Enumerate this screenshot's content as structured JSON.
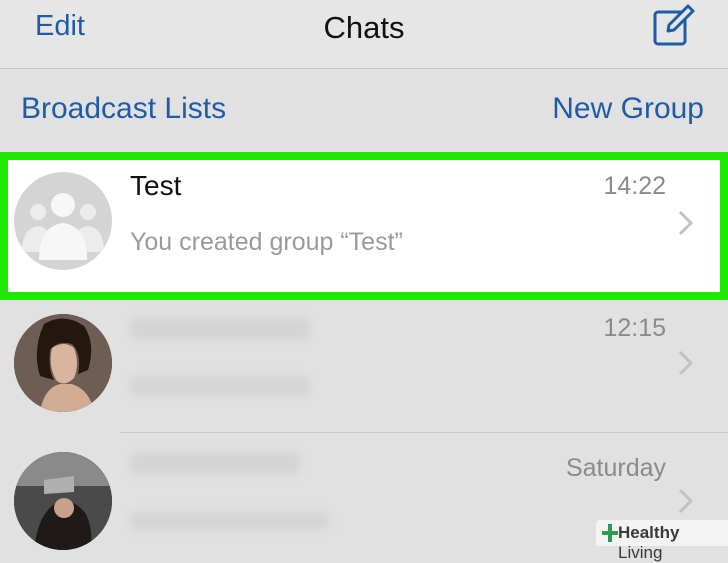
{
  "navbar": {
    "edit_label": "Edit",
    "title": "Chats",
    "compose_icon": "compose-icon"
  },
  "subbar": {
    "broadcast_label": "Broadcast Lists",
    "new_group_label": "New Group"
  },
  "chats": [
    {
      "name": "Test",
      "time": "14:22",
      "preview": "You created group “Test”",
      "avatar": "group-avatar-icon",
      "highlighted": true
    },
    {
      "name": "",
      "time": "12:15",
      "preview": "",
      "avatar": "contact-photo"
    },
    {
      "name": "",
      "time": "Saturday",
      "preview": "",
      "avatar": "contact-photo"
    }
  ],
  "watermark": {
    "brand_bold": "Healthy",
    "brand_rest": "Living"
  },
  "colors": {
    "accent": "#1f5ca8",
    "highlight": "#1ee800",
    "background": "#e1e1e1"
  }
}
